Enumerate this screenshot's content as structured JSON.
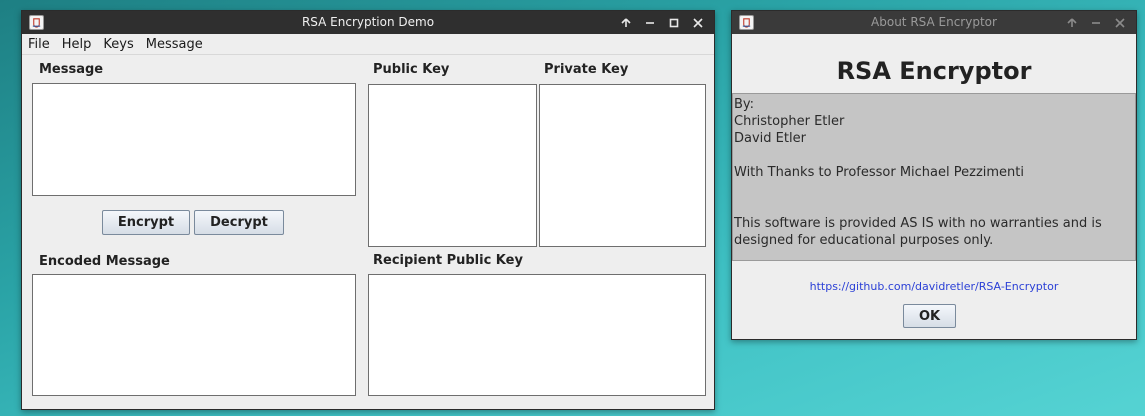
{
  "main_window": {
    "title": "RSA Encryption Demo",
    "menu": [
      "File",
      "Help",
      "Keys",
      "Message"
    ],
    "labels": {
      "message": "Message",
      "public_key": "Public Key",
      "private_key": "Private Key",
      "encoded_message": "Encoded Message",
      "recipient_public_key": "Recipient Public Key"
    },
    "buttons": {
      "encrypt": "Encrypt",
      "decrypt": "Decrypt"
    }
  },
  "about_window": {
    "title": "About RSA Encryptor",
    "heading": "RSA Encryptor",
    "by_label": "By:",
    "authors": [
      "Christopher Etler",
      "David Etler"
    ],
    "thanks": "With Thanks to Professor Michael Pezzimenti",
    "disclaimer_line1": "This software is provided AS IS with no warranties and is",
    "disclaimer_line2": "designed for educational purposes only.",
    "link": "https://github.com/davidretler/RSA-Encryptor",
    "ok_label": "OK"
  },
  "colors": {
    "titlebar_active": "#2f2f2f",
    "titlebar_inactive": "#3a3a3a",
    "window_bg": "#eeeeee",
    "about_box_bg": "#c5c5c5",
    "link": "#2a3fd6",
    "desktop_teal": "#3fc1c4"
  },
  "icons": {
    "app": "java-app-icon",
    "maximize": "up-arrow-icon",
    "minimize": "minimize-icon",
    "restore": "maximize-icon",
    "close": "close-icon"
  }
}
